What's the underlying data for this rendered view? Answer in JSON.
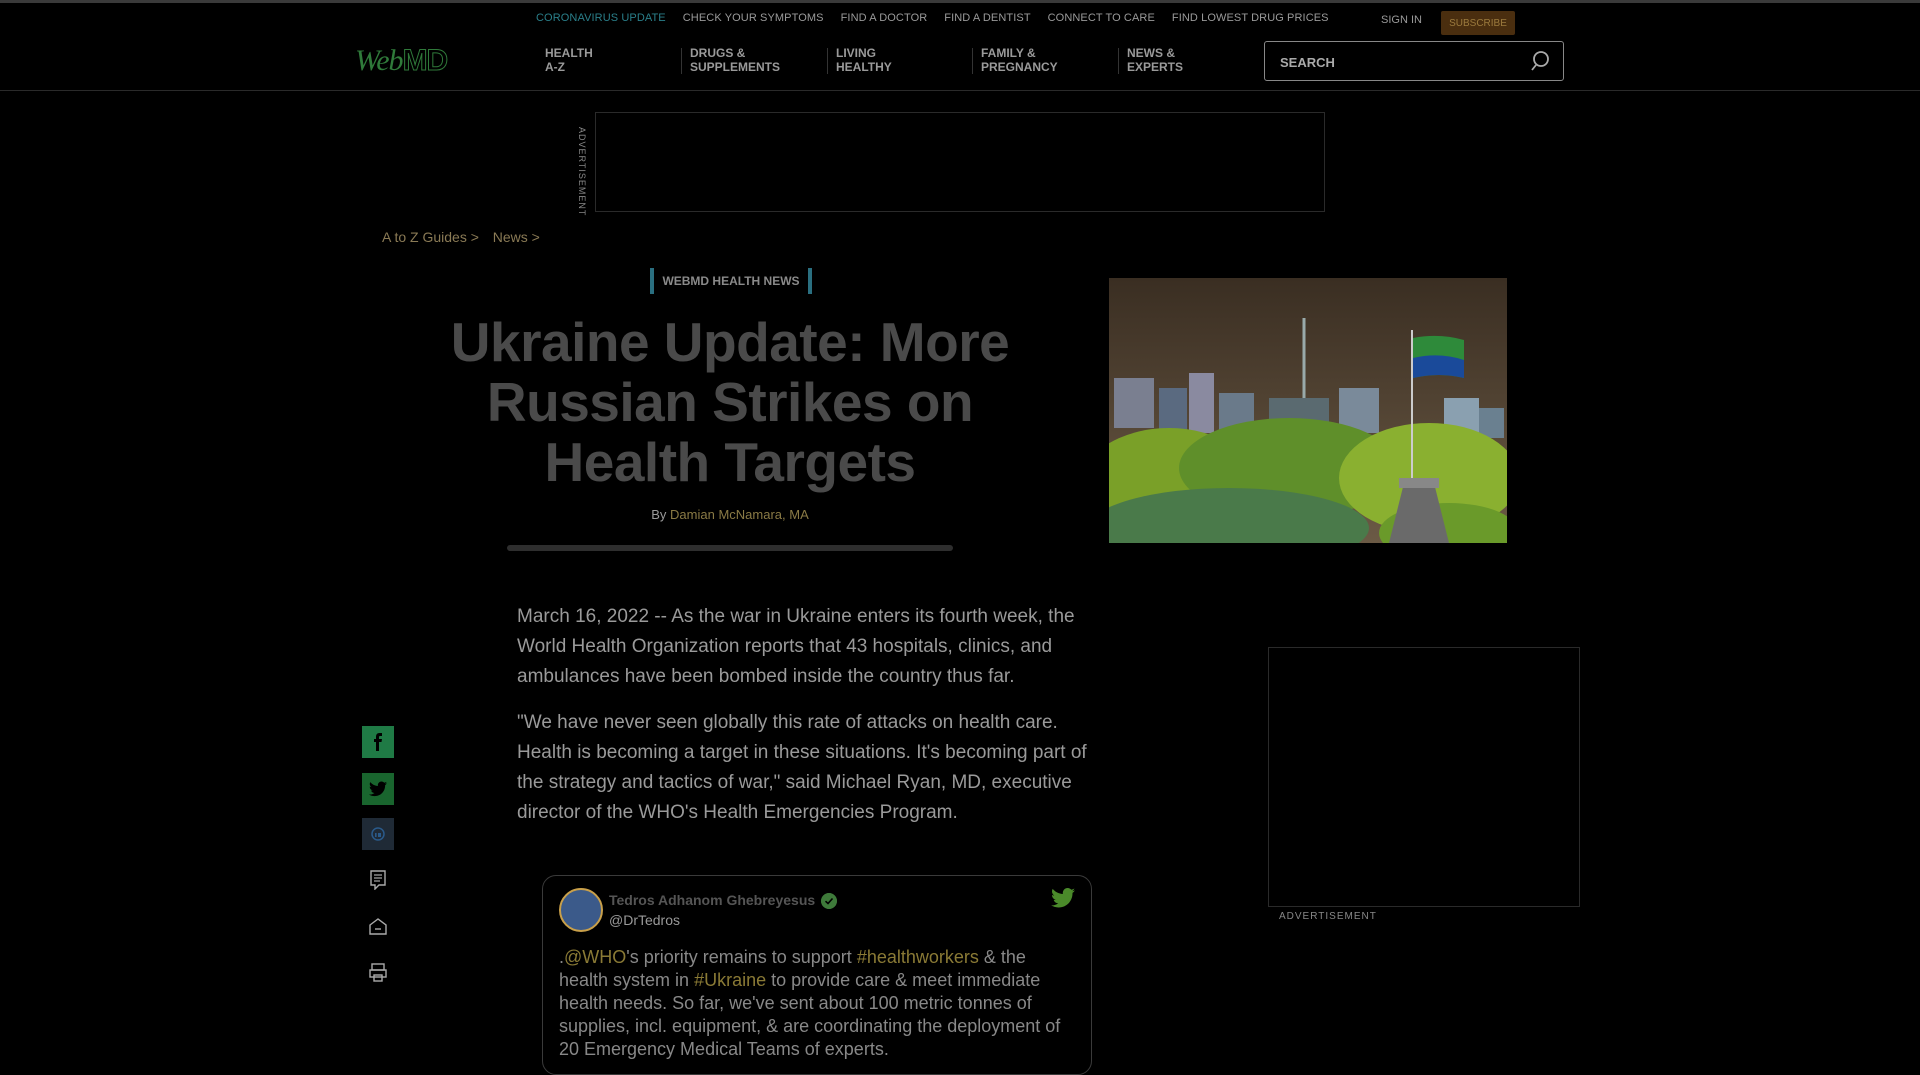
{
  "topbar": {
    "links": [
      "CORONAVIRUS UPDATE",
      "CHECK YOUR SYMPTOMS",
      "FIND A DOCTOR",
      "FIND A DENTIST",
      "CONNECT TO CARE",
      "FIND LOWEST DRUG PRICES"
    ],
    "sign_in": "SIGN IN",
    "subscribe": "SUBSCRIBE"
  },
  "logo": {
    "web": "Web",
    "md": "MD"
  },
  "nav": [
    {
      "line1": "HEALTH",
      "line2": "A-Z"
    },
    {
      "line1": "DRUGS &",
      "line2": "SUPPLEMENTS"
    },
    {
      "line1": "LIVING",
      "line2": "HEALTHY"
    },
    {
      "line1": "FAMILY &",
      "line2": "PREGNANCY"
    },
    {
      "line1": "NEWS &",
      "line2": "EXPERTS"
    }
  ],
  "search": {
    "placeholder": "SEARCH"
  },
  "ads": {
    "banner_label": "ADVERTISEMENT",
    "side_label": "ADVERTISEMENT"
  },
  "breadcrumbs": [
    "A to Z Guides >",
    "News >"
  ],
  "article": {
    "kicker": "WEBMD HEALTH NEWS",
    "title": "Ukraine Update: More Russian Strikes on Health Targets",
    "byline_prefix": "By ",
    "author": "Damian McNamara, MA",
    "paragraphs": [
      "March 16, 2022 -- As the war in Ukraine enters its fourth week, the World Health Organization reports that 43 hospitals, clinics, and ambulances have been bombed inside the country thus far.",
      "\"We have never seen globally this rate of attacks on health care. Health is becoming a target in these situations. It's becoming part of the strategy and tactics of war,\" said Michael Ryan, MD, executive director of the WHO's Health Emergencies Program."
    ]
  },
  "tweet": {
    "name": "Tedros Adhanom Ghebreyesus",
    "handle": "@DrTedros",
    "text_parts": [
      {
        "t": ".",
        "link": false
      },
      {
        "t": "@WHO",
        "link": true
      },
      {
        "t": "'s priority remains to support ",
        "link": false
      },
      {
        "t": "#healthworkers",
        "link": true
      },
      {
        "t": " & the health system in ",
        "link": false
      },
      {
        "t": "#Ukraine",
        "link": true
      },
      {
        "t": " to provide care & meet immediate health needs. So far, we've sent about 100 metric tonnes of supplies, incl. equipment, & are coordinating the deployment of 20 Emergency Medical Teams of experts.",
        "link": false
      }
    ]
  },
  "icons": [
    "search-icon",
    "facebook-icon",
    "twitter-icon",
    "linkedin-icon",
    "comment-icon",
    "home-icon",
    "print-icon",
    "verified-icon",
    "twitter-bird-icon"
  ]
}
